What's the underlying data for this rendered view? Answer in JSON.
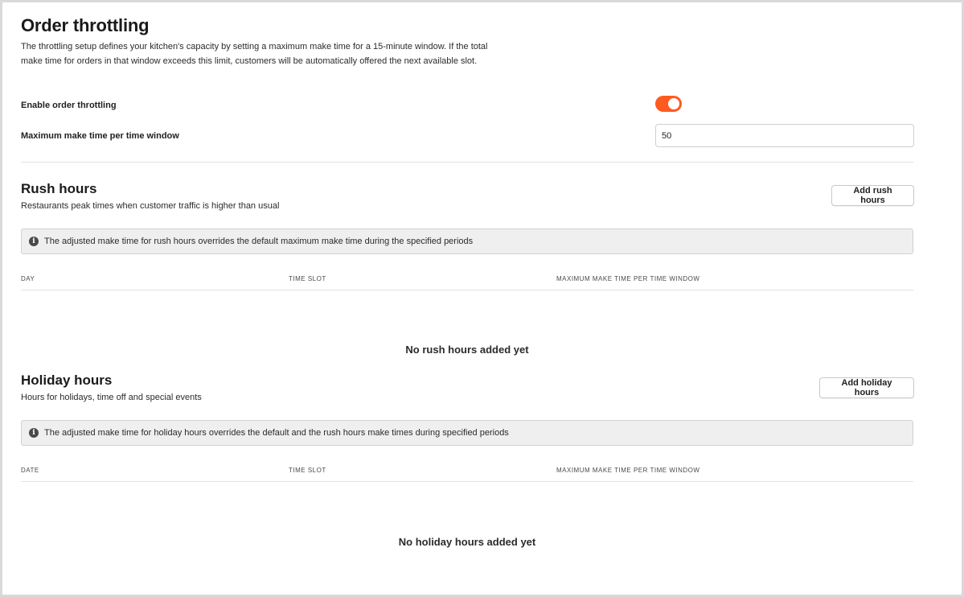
{
  "header": {
    "title": "Order throttling",
    "description": "The throttling setup defines your kitchen's capacity by setting a maximum make time for a 15-minute window. If the total make time for orders in that window exceeds this limit, customers will be automatically offered the next available slot."
  },
  "settings": {
    "enable_label": "Enable order throttling",
    "enabled": true,
    "max_label": "Maximum make time per time window",
    "max_value": "50"
  },
  "rush": {
    "title": "Rush hours",
    "subtitle": "Restaurants peak times when customer traffic is higher than usual",
    "add_label": "Add rush hours",
    "banner": "The adjusted make time for rush hours overrides the default maximum make time during the specified periods",
    "columns": [
      "DAY",
      "TIME SLOT",
      "MAXIMUM MAKE TIME PER TIME WINDOW"
    ],
    "empty": "No rush hours added yet"
  },
  "holiday": {
    "title": "Holiday hours",
    "subtitle": "Hours for holidays, time off and special events",
    "add_label": "Add holiday hours",
    "banner": "The adjusted make time for holiday hours overrides the default and the rush hours make times during specified periods",
    "columns": [
      "DATE",
      "TIME SLOT",
      "MAXIMUM MAKE TIME PER TIME WINDOW"
    ],
    "empty": "No holiday hours added yet"
  },
  "colors": {
    "accent": "#ff5a1f"
  }
}
